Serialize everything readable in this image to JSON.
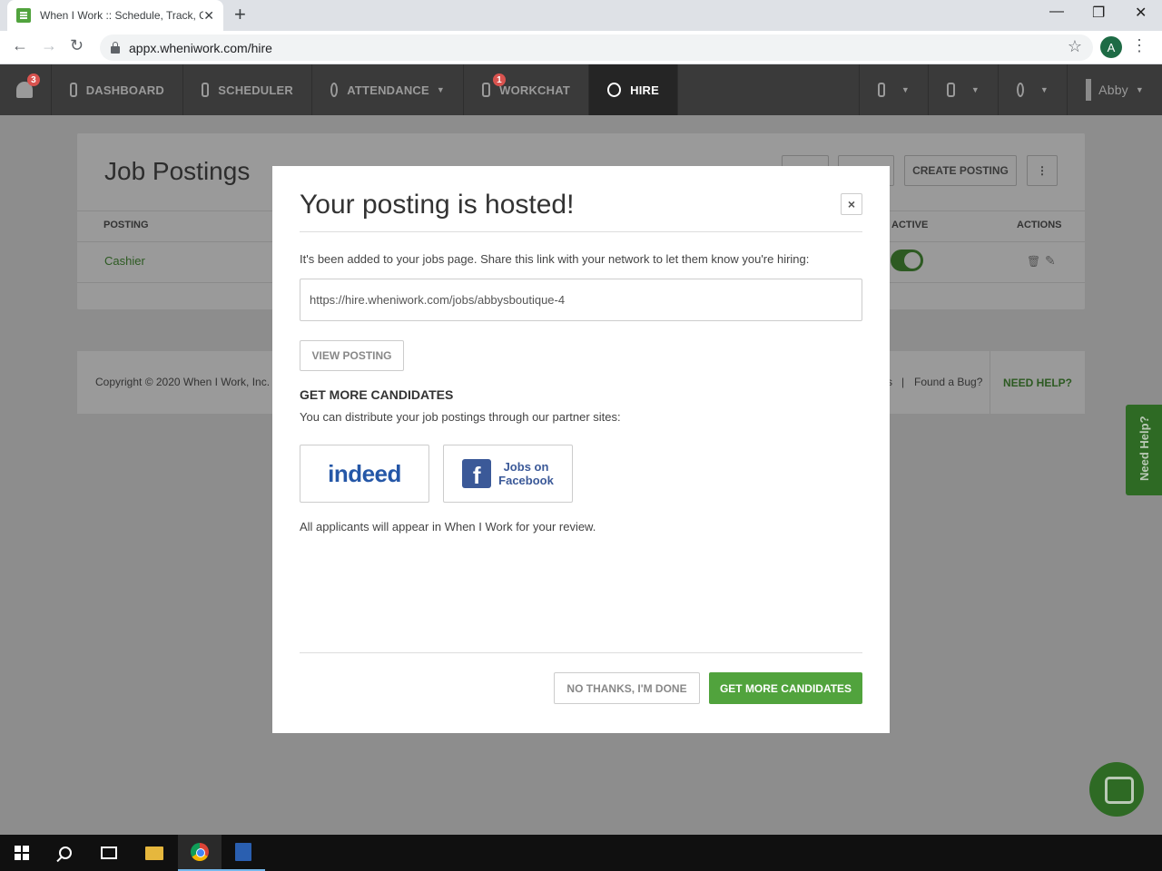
{
  "browser": {
    "tab_title": "When I Work :: Schedule, Track, C",
    "tab_close": "✕",
    "new_tab": "+",
    "url": "appx.wheniwork.com/hire",
    "profile_initial": "A",
    "win_minimize": "—",
    "win_restore": "❐",
    "win_close": "✕",
    "back": "←",
    "forward": "→",
    "reload": "↻",
    "star": "☆",
    "menu": "⋮"
  },
  "nav": {
    "notifications_badge": "3",
    "items": [
      {
        "label": "DASHBOARD",
        "icon": "dashboard-icon"
      },
      {
        "label": "SCHEDULER",
        "icon": "calendar-icon"
      },
      {
        "label": "ATTENDANCE",
        "icon": "clock-icon"
      },
      {
        "label": "WORKCHAT",
        "icon": "chat-icon",
        "badge": "1"
      },
      {
        "label": "HIRE",
        "icon": "people-icon"
      }
    ],
    "user_name": "Abby",
    "caret": "▼"
  },
  "page": {
    "title": "Job Postings",
    "create_posting": "CREATE POSTING",
    "more": "⋮",
    "columns": {
      "posting": "POSTING",
      "active": "ACTIVE",
      "actions": "ACTIONS"
    },
    "row": {
      "posting": "Cashier"
    },
    "trash": "🗑",
    "edit": "✎"
  },
  "footer": {
    "copyright": "Copyright © 2020 When I Work, Inc.",
    "link_s": "s",
    "separator": "|",
    "found_bug": "Found a Bug?",
    "need_help": "NEED HELP?"
  },
  "side_help": "Need Help?",
  "modal": {
    "title": "Your posting is hosted!",
    "close": "×",
    "intro": "It's been added to your jobs page. Share this link with your network to let them know you're hiring:",
    "link": "https://hire.wheniwork.com/jobs/abbysboutique-4",
    "view_posting": "VIEW POSTING",
    "section_title": "GET MORE CANDIDATES",
    "section_sub": "You can distribute your job postings through our partner sites:",
    "indeed": "indeed",
    "fb_glyph": "f",
    "fb_line1": "Jobs on",
    "fb_line2": "Facebook",
    "note": "All applicants will appear in When I Work for your review.",
    "no_thanks": "NO THANKS, I'M DONE",
    "get_more": "GET MORE CANDIDATES"
  }
}
